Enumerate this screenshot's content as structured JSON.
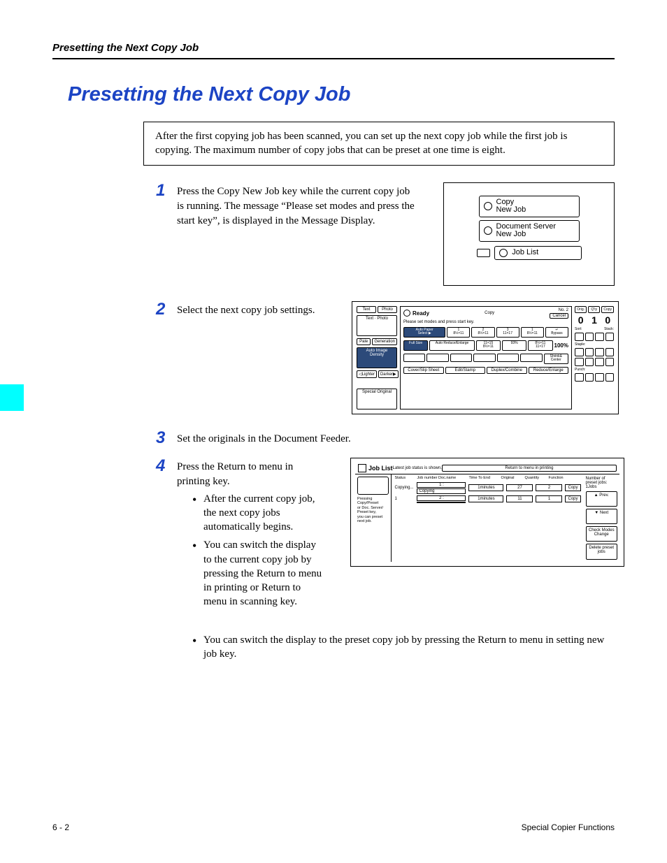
{
  "running_head": "Presetting the Next Copy Job",
  "heading": "Presetting the Next Copy Job",
  "intro": "After the first copying job has been scanned, you can set up the next copy job while the first job is copying. The maximum number of copy jobs that can be preset at one time is eight.",
  "steps": {
    "s1": {
      "num": "1",
      "text": "Press the Copy New Job key while the current copy job is running. The message “Please set modes and press the start key”, is displayed in the Message Display."
    },
    "s2": {
      "num": "2",
      "text": "Select the next copy job settings."
    },
    "s3": {
      "num": "3",
      "text": "Set the originals in the Document Feeder."
    },
    "s4": {
      "num": "4",
      "text": "Press the Return to menu in printing key."
    }
  },
  "bullets": {
    "b1": "After the current copy job, the next copy jobs automatically begins.",
    "b2": "You can switch the display to the current copy job by pressing the Return to menu in printing or Return to menu in scanning key.",
    "b3": "You can switch the display to the preset copy job by pressing the Return to menu in setting new job key."
  },
  "fig1": {
    "copy_new_job": "Copy\nNew Job",
    "doc_server_new_job": "Document Server\nNew Job",
    "job_list": "Job List"
  },
  "fig2": {
    "left": {
      "text": "Text",
      "photo": "Photo",
      "text_photo": "Text · Photo",
      "pale": "Pale",
      "generation": "Generation",
      "auto_density": "Auto Image Density",
      "lighter": "◁Lighter",
      "darker": "Darker▶",
      "special": "Special Original"
    },
    "ready": "Ready",
    "sub": "Please set modes and press start key.",
    "copy_label": "Copy",
    "no_label": "No. 2",
    "cancel": "Cancel",
    "paper_row": {
      "auto_paper": "Auto Paper\nSelect ▶",
      "p1": "1\n8½×11",
      "p2": "2\n8½×11",
      "p3": "3\n11×17",
      "p4": "1\n8½×11",
      "bypass": "↵\nBypass"
    },
    "zoom_row": {
      "full": "Full Size",
      "auto_re": "Auto Reduce/Enlarge",
      "r1": "11×15\n8½×11",
      "r2": "93%",
      "r3": "8½×11\n11×17",
      "r4": "100%"
    },
    "shrink": "Shrink&\nCenter",
    "bottom": {
      "cover": "Cover/Slip Sheet",
      "edit": "Edit/Stamp",
      "duplex": "Duplex/Combine",
      "reduce": "Reduce/Enlarge"
    },
    "right": {
      "orig": "Orig.",
      "qty": "Q'ty",
      "copy": "Copy",
      "orig_n": "0",
      "qty_n": "1",
      "copy_n": "0",
      "sort": "Sort:",
      "stack": "Stack:",
      "staple": "Staple:",
      "punch": "Punch:"
    }
  },
  "fig3": {
    "title": "Job List",
    "status_msg": "Latest job status is shown.",
    "return_btn": "Return to menu in printing",
    "headers": {
      "status": "Status",
      "job": "Job number Doc.name",
      "time": "Time To End",
      "orig": "Original",
      "qty": "Quantity",
      "func": "Function"
    },
    "left_note": "Pressing Copy/Preset\nor Doc. Server/\nPreset key,\nyou can preset next job.",
    "copying": "Copying...",
    "row1": {
      "job": "1 :",
      "doc": "Copying",
      "time": "1minutes",
      "orig": "27",
      "qty": "2",
      "func": "Copy"
    },
    "row2": {
      "status": "1",
      "job": "2 :",
      "doc": "",
      "time": "1minutes",
      "orig": "11",
      "qty": "1",
      "func": "Copy"
    },
    "right": {
      "preset_count": "Number of preset jobs:\n1Jobs",
      "up": "▲ Prev.",
      "down": "▼ Next",
      "check": "Check Modes\nChange",
      "delete": "Delete preset jobs"
    }
  },
  "footer": {
    "left": "6 - 2",
    "right": "Special Copier Functions"
  }
}
